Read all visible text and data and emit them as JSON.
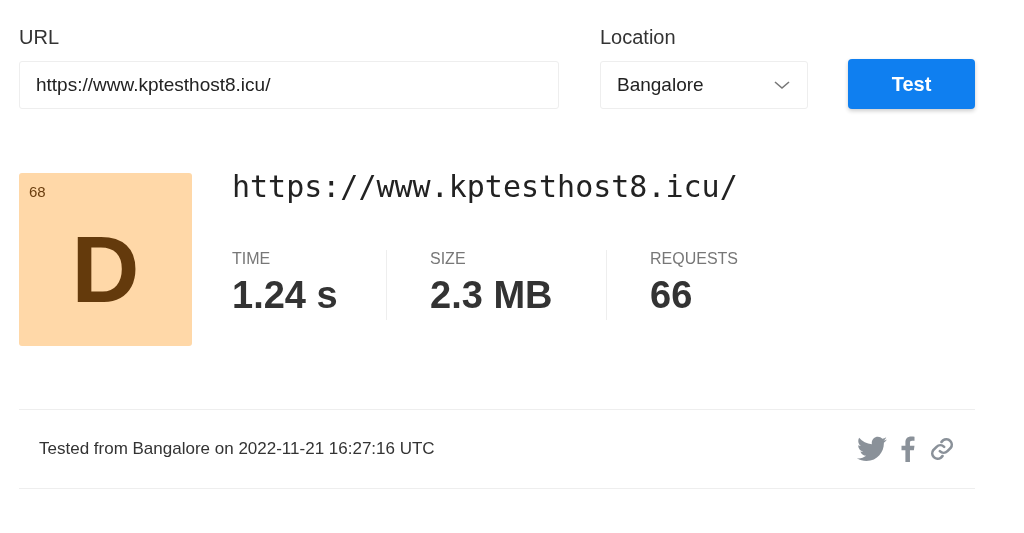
{
  "form": {
    "url_label": "URL",
    "url_value": "https://www.kptesthost8.icu/",
    "location_label": "Location",
    "location_value": "Bangalore",
    "button": "Test"
  },
  "result": {
    "score": "68",
    "grade": "D",
    "url": "https://www.kptesthost8.icu/",
    "metrics": [
      {
        "label": "TIME",
        "value": "1.24 s"
      },
      {
        "label": "SIZE",
        "value": "2.3 MB"
      },
      {
        "label": "REQUESTS",
        "value": "66"
      }
    ]
  },
  "footer": {
    "text": "Tested from Bangalore on 2022-11-21 16:27:16 UTC"
  }
}
